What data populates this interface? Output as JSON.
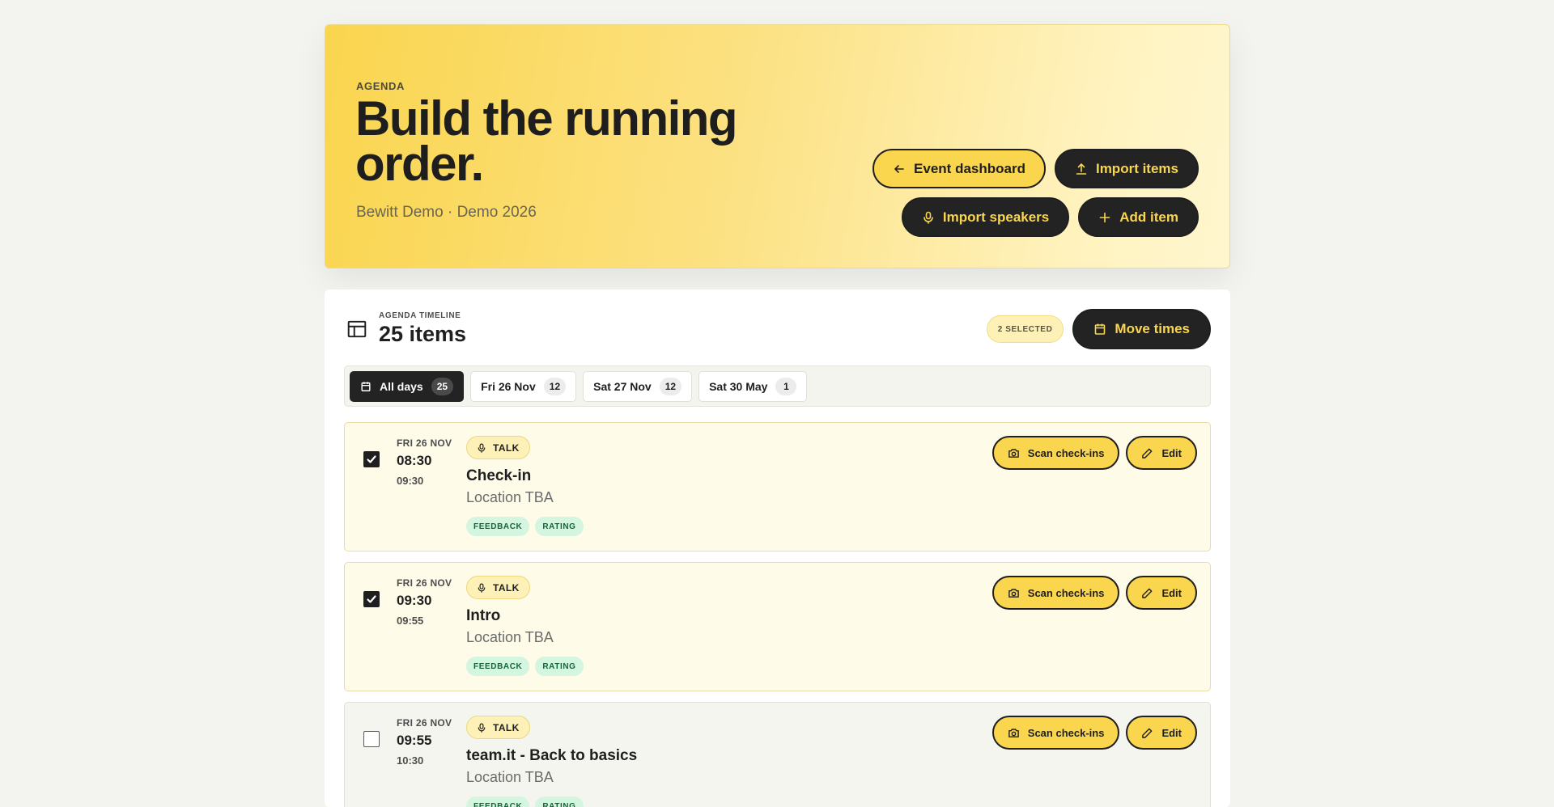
{
  "hero": {
    "eyebrow": "AGENDA",
    "title": "Build the running order.",
    "subtitle": "Bewitt Demo · Demo 2026",
    "buttons": {
      "event_dashboard": "Event dashboard",
      "import_items": "Import items",
      "import_speakers": "Import speakers",
      "add_item": "Add item"
    }
  },
  "timeline": {
    "eyebrow": "AGENDA TIMELINE",
    "count_label": "25 items",
    "selected_badge": "2 SELECTED",
    "move_times": "Move times",
    "day_tabs": [
      {
        "label": "All days",
        "count": "25",
        "active": true
      },
      {
        "label": "Fri 26 Nov",
        "count": "12",
        "active": false
      },
      {
        "label": "Sat 27 Nov",
        "count": "12",
        "active": false
      },
      {
        "label": "Sat 30 May",
        "count": "1",
        "active": false
      }
    ],
    "items": [
      {
        "date": "FRI 26 NOV",
        "start": "08:30",
        "end": "09:30",
        "type": "TALK",
        "title": "Check-in",
        "location": "Location TBA",
        "tags": [
          "FEEDBACK",
          "RATING"
        ],
        "selected": true,
        "scan_label": "Scan check-ins",
        "edit_label": "Edit"
      },
      {
        "date": "FRI 26 NOV",
        "start": "09:30",
        "end": "09:55",
        "type": "TALK",
        "title": "Intro",
        "location": "Location TBA",
        "tags": [
          "FEEDBACK",
          "RATING"
        ],
        "selected": true,
        "scan_label": "Scan check-ins",
        "edit_label": "Edit"
      },
      {
        "date": "FRI 26 NOV",
        "start": "09:55",
        "end": "10:30",
        "type": "TALK",
        "title": "team.it - Back to basics",
        "location": "Location TBA",
        "tags": [
          "FEEDBACK",
          "RATING"
        ],
        "selected": false,
        "scan_label": "Scan check-ins",
        "edit_label": "Edit"
      }
    ]
  },
  "colors": {
    "accent": "#fad54e",
    "dark": "#232323",
    "background": "#f3f3f0",
    "tag_bg": "#d4f5df",
    "tag_text": "#16653a"
  },
  "icons": {
    "event_dashboard": "arrow-left-icon",
    "import_items": "upload-icon",
    "import_speakers": "microphone-icon",
    "add_item": "plus-icon",
    "timeline": "table-icon",
    "move_times": "calendar-icon",
    "scan": "camera-icon",
    "edit": "pencil-icon"
  }
}
